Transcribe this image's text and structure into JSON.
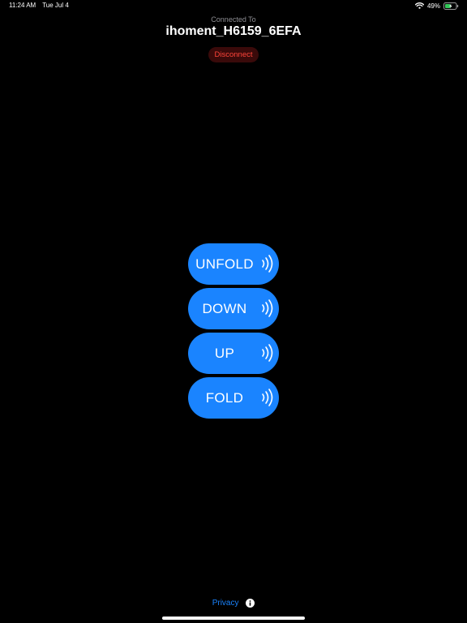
{
  "status_bar": {
    "time": "11:24 AM",
    "date": "Tue Jul 4",
    "battery_percent": "49%",
    "battery_level": 0.49,
    "icons": [
      "wifi-icon",
      "battery-charging-icon"
    ]
  },
  "header": {
    "connected_label": "Connected To",
    "device_name": "ihoment_H6159_6EFA",
    "disconnect_label": "Disconnect"
  },
  "commands": [
    {
      "label": "UNFOLD",
      "icon": "signal-waves-icon"
    },
    {
      "label": "DOWN",
      "icon": "signal-waves-icon"
    },
    {
      "label": "UP",
      "icon": "signal-waves-icon"
    },
    {
      "label": "FOLD",
      "icon": "signal-waves-icon"
    }
  ],
  "footer": {
    "privacy_label": "Privacy",
    "info_icon": "info-icon"
  },
  "colors": {
    "background": "#000000",
    "accent": "#1a84ff",
    "disconnect_text": "#ff453a",
    "disconnect_bg": "#3a0a0a",
    "secondary_text": "#8e8e93"
  }
}
